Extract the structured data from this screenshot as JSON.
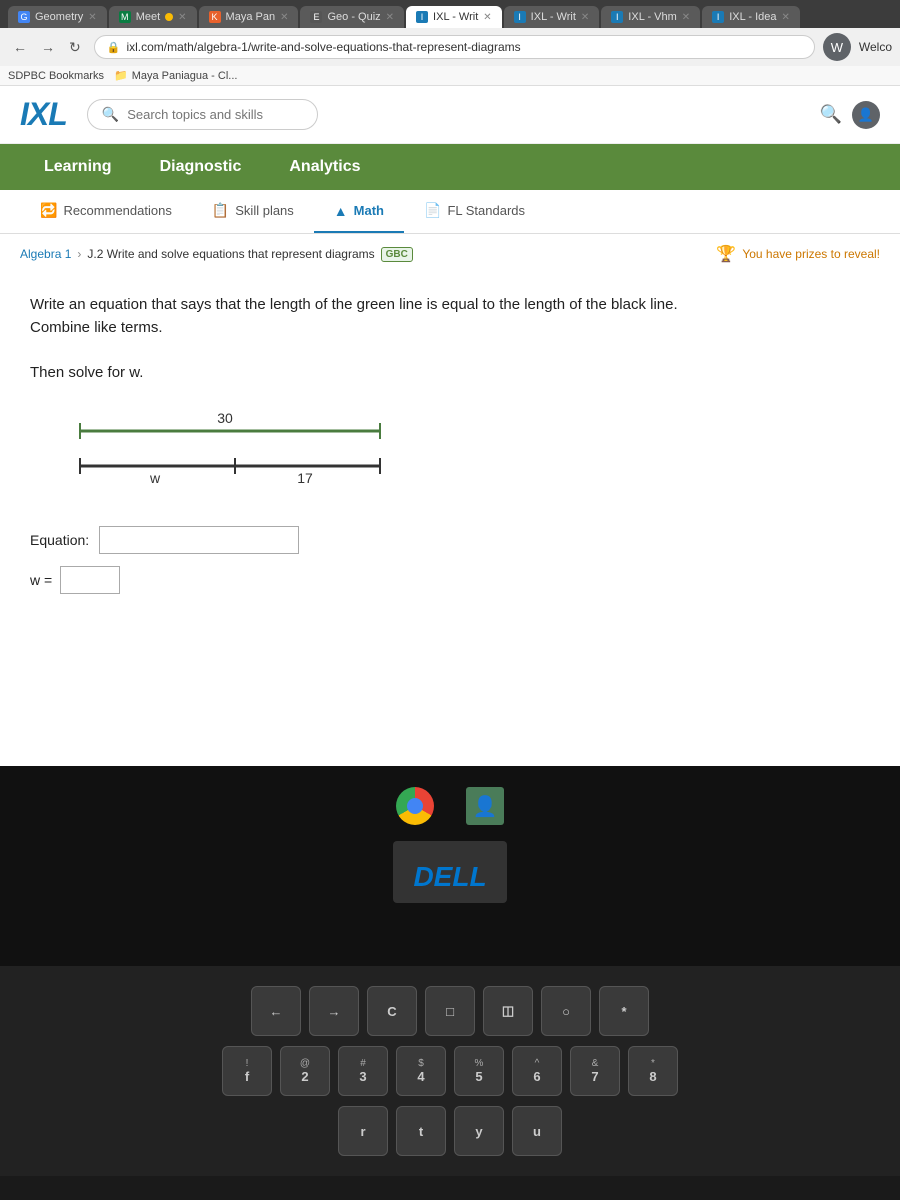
{
  "browser": {
    "tabs": [
      {
        "id": "geometry",
        "label": "Geometry",
        "icon": "G",
        "active": false
      },
      {
        "id": "meet",
        "label": "Meet",
        "icon": "M",
        "active": false
      },
      {
        "id": "maya",
        "label": "Maya Pan",
        "icon": "K",
        "active": false
      },
      {
        "id": "geo-quiz",
        "label": "Geo - Quiz",
        "icon": "E",
        "active": false
      },
      {
        "id": "ixl-write1",
        "label": "IXL - Writ",
        "icon": "I",
        "active": true
      },
      {
        "id": "ixl-write2",
        "label": "IXL - Writ",
        "icon": "I",
        "active": false
      },
      {
        "id": "ixl-vhm",
        "label": "IXL - Vhm",
        "icon": "I",
        "active": false
      },
      {
        "id": "ixl-idea",
        "label": "IXL - Idea",
        "icon": "I",
        "active": false
      }
    ],
    "address": "ixl.com/math/algebra-1/write-and-solve-equations-that-represent-diagrams",
    "bookmarks": [
      "SDPBC Bookmarks",
      "Maya Paniagua - Cl..."
    ],
    "profile": "W",
    "welcome": "Welco"
  },
  "ixl": {
    "logo": "IXL",
    "search_placeholder": "Search topics and skills",
    "nav": {
      "tabs": [
        "Learning",
        "Diagnostic",
        "Analytics"
      ],
      "active": "Learning"
    },
    "sub_nav": {
      "items": [
        {
          "label": "Recommendations",
          "icon": "🔁"
        },
        {
          "label": "Skill plans",
          "icon": "📋"
        },
        {
          "label": "Math",
          "icon": "▲"
        },
        {
          "label": "FL Standards",
          "icon": "📄"
        }
      ],
      "active": "Math"
    },
    "breadcrumb": {
      "items": [
        "Algebra 1",
        "J.2 Write and solve equations that represent diagrams"
      ],
      "badge": "GBC"
    },
    "prizes_text": "You have prizes to reveal!",
    "question": {
      "text": "Write an equation that says that the length of the green line is equal to the length of the black line. Combine like terms.",
      "subtext": "Then solve for w.",
      "diagram": {
        "green_line_label": "30",
        "black_line_label": "w",
        "black_line_label2": "17"
      }
    },
    "equation_label": "Equation:",
    "equation_placeholder": "",
    "w_label": "w =",
    "w_placeholder": ""
  },
  "taskbar": {
    "dell_logo": "DELL"
  },
  "keyboard": {
    "row1": [
      {
        "top": "",
        "bottom": "←"
      },
      {
        "top": "",
        "bottom": "→"
      },
      {
        "top": "",
        "bottom": "C"
      },
      {
        "top": "",
        "bottom": "□"
      },
      {
        "top": "",
        "bottom": "◫"
      },
      {
        "top": "",
        "bottom": "○"
      },
      {
        "top": "",
        "bottom": "*"
      }
    ],
    "row2": [
      {
        "top": "!",
        "bottom": "f"
      },
      {
        "top": "@",
        "bottom": "2"
      },
      {
        "top": "#",
        "bottom": "3"
      },
      {
        "top": "$",
        "bottom": "4"
      },
      {
        "top": "%",
        "bottom": "5"
      },
      {
        "top": "^",
        "bottom": "6"
      },
      {
        "top": "&",
        "bottom": "7"
      },
      {
        "top": "*",
        "bottom": "8"
      }
    ],
    "row3_chars": [
      "r",
      "t",
      "y",
      "u"
    ]
  }
}
